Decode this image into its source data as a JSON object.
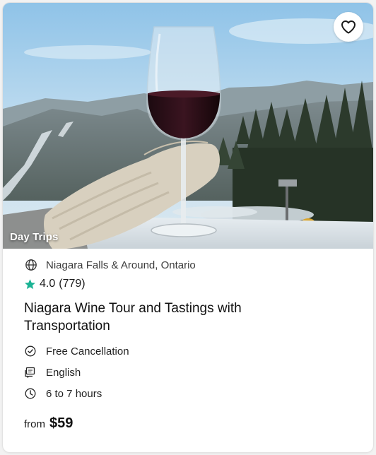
{
  "card": {
    "category": "Day Trips",
    "location": "Niagara Falls & Around, Ontario",
    "rating": "4.0",
    "review_count": "(779)",
    "title": "Niagara Wine Tour and Tastings with Transportation",
    "features": [
      {
        "icon": "check-circle-icon",
        "label": "Free Cancellation"
      },
      {
        "icon": "language-icon",
        "label": "English"
      },
      {
        "icon": "clock-icon",
        "label": "6 to 7 hours"
      }
    ],
    "price_prefix": "from",
    "price": "$59"
  },
  "colors": {
    "star": "#1ab394",
    "text": "#1f1f1f"
  }
}
